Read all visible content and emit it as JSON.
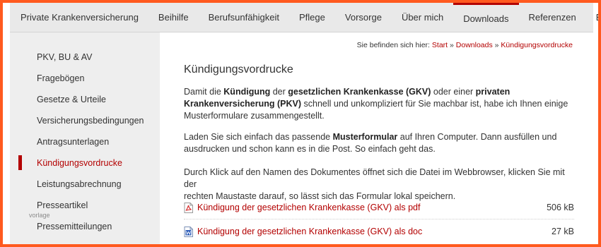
{
  "nav": {
    "items": [
      {
        "label": "Private Krankenversicherung"
      },
      {
        "label": "Beihilfe"
      },
      {
        "label": "Berufsunfähigkeit"
      },
      {
        "label": "Pflege"
      },
      {
        "label": "Vorsorge"
      },
      {
        "label": "Über mich"
      },
      {
        "label": "Downloads"
      },
      {
        "label": "Referenzen"
      },
      {
        "label": "Blog"
      }
    ],
    "active": "Downloads"
  },
  "sidebar": {
    "items": [
      {
        "label": "PKV, BU & AV"
      },
      {
        "label": "Fragebögen"
      },
      {
        "label": "Gesetze & Urteile"
      },
      {
        "label": "Versicherungsbedingungen"
      },
      {
        "label": "Antragsunterlagen"
      },
      {
        "label": "Kündigungsvordrucke"
      },
      {
        "label": "Leistungsabrechnung"
      },
      {
        "label": "Presseartikel"
      },
      {
        "label": "Pressemitteilungen"
      }
    ],
    "active": "Kündigungsvordrucke"
  },
  "watermark": "vorlage",
  "breadcrumb": {
    "prefix": "Sie befinden sich hier:",
    "items": [
      "Start",
      "Downloads",
      "Kündigungsvordrucke"
    ],
    "separator": "»"
  },
  "main": {
    "title": "Kündigungsvordrucke",
    "p1": {
      "t1": "Damit die ",
      "b1": "Kündigung",
      "t2": " der ",
      "b2": "gesetzlichen Krankenkasse (GKV)",
      "t3": " oder einer ",
      "b3": "privaten",
      "b4": "Krankenversicherung (PKV)",
      "t4": " schnell und unkompliziert für Sie machbar ist, habe ich Ihnen einige",
      "t5": "Musterformulare zusammengestellt."
    },
    "p2": {
      "t1": "Laden Sie sich einfach das passende ",
      "b1": "Musterformular",
      "t2": " auf Ihren Computer. Dann ausfüllen und",
      "t3": "ausdrucken und schon kann es in die Post. So einfach geht das."
    },
    "p3": {
      "line1": "Durch Klick auf den Namen des Dokumentes öffnet sich die Datei im Webbrowser, klicken Sie mit der",
      "line2": "rechten Maustaste darauf, so lässt sich das Formular lokal speichern."
    },
    "downloads": [
      {
        "label": "Kündigung der gesetzlichen Krankenkasse (GKV) als pdf",
        "size": "506 kB",
        "icon": "pdf-file-icon"
      },
      {
        "label": "Kündigung der gesetzlichen Krankenkasse (GKV) als doc",
        "size": "27 kB",
        "icon": "doc-file-icon"
      }
    ]
  },
  "colors": {
    "accent": "#b30000",
    "border_frame": "#ff5a1f",
    "nav_bg": "#e9e9e9",
    "sidebar_bg": "#eeeeee"
  }
}
